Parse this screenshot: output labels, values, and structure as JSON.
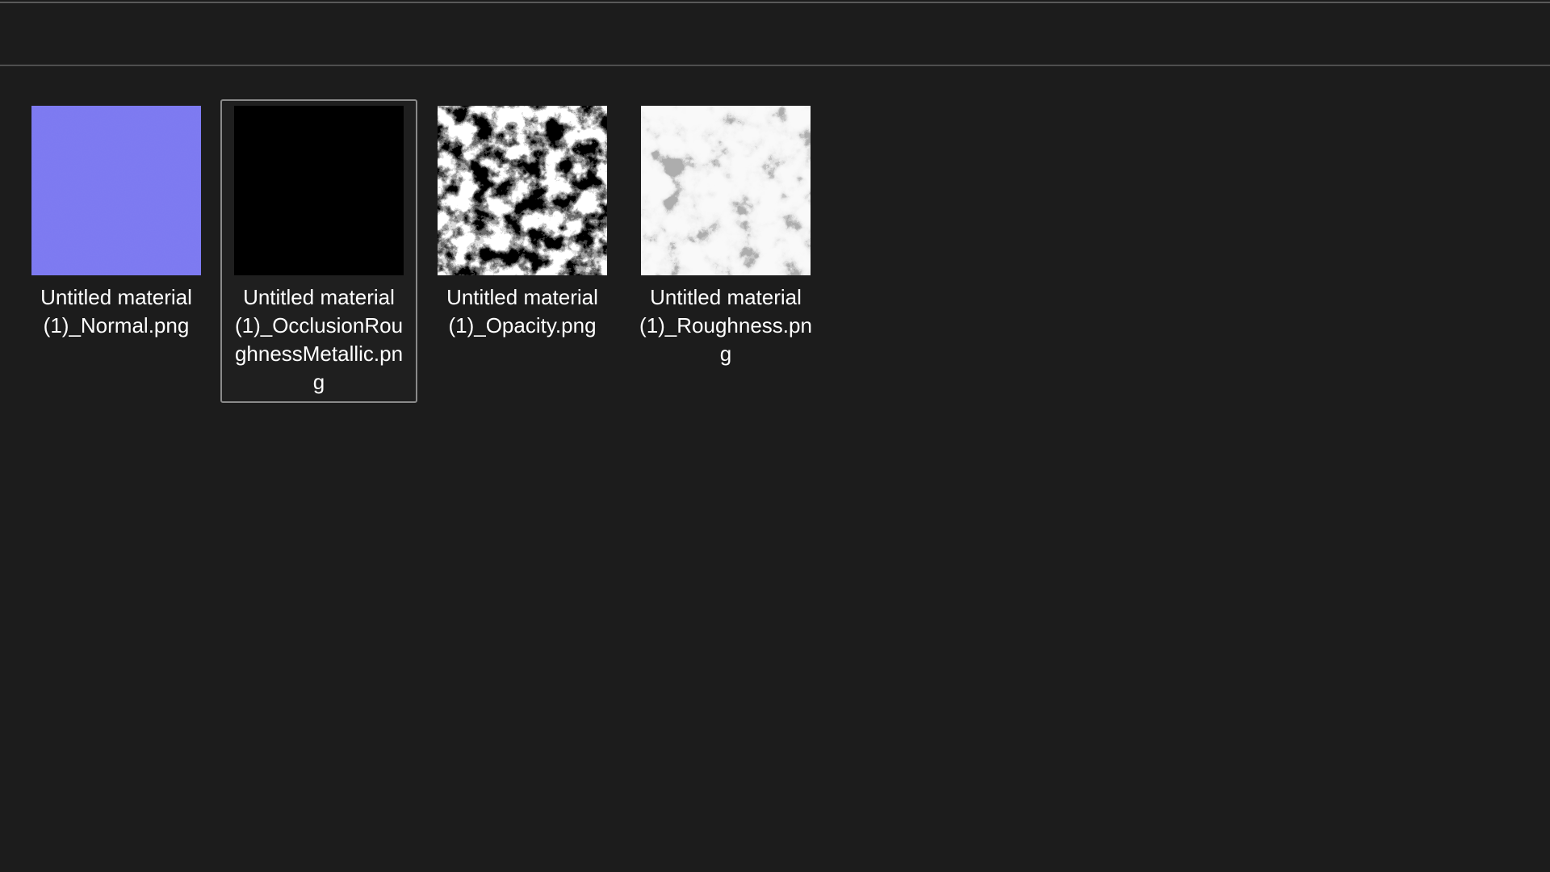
{
  "files": [
    {
      "name": "Untitled material (1)_Normal.png",
      "thumb_icon": "normal-map-thumbnail",
      "thumb_color": "#7b78f1",
      "selected": false
    },
    {
      "name": "Untitled material (1)_OcclusionRoughnessMetallic.png",
      "thumb_icon": "occlusion-roughness-metallic-thumbnail",
      "thumb_color": "#000000",
      "selected": true
    },
    {
      "name": "Untitled material (1)_Opacity.png",
      "thumb_icon": "opacity-map-thumbnail",
      "thumb_color": "#1a1a1a",
      "selected": false
    },
    {
      "name": "Untitled material (1)_Roughness.png",
      "thumb_icon": "roughness-map-thumbnail",
      "thumb_color": "#e4e4e4",
      "selected": false
    }
  ]
}
